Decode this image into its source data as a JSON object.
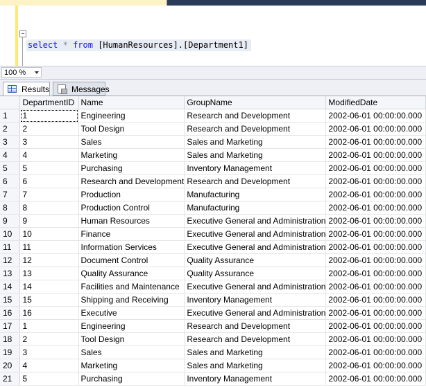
{
  "editor": {
    "sql_keyword_select": "select",
    "sql_star": "*",
    "sql_keyword_from": "from",
    "sql_object": "[HumanResources].[Department1]",
    "collapse_glyph": "−"
  },
  "zoom": {
    "value": "100 %"
  },
  "tabs": {
    "results": "Results",
    "messages": "Messages"
  },
  "grid": {
    "columns": [
      "DepartmentID",
      "Name",
      "GroupName",
      "ModifiedDate"
    ],
    "rows": [
      [
        "1",
        "1",
        "Engineering",
        "Research and Development",
        "2002-06-01 00:00:00.000"
      ],
      [
        "2",
        "2",
        "Tool Design",
        "Research and Development",
        "2002-06-01 00:00:00.000"
      ],
      [
        "3",
        "3",
        "Sales",
        "Sales and Marketing",
        "2002-06-01 00:00:00.000"
      ],
      [
        "4",
        "4",
        "Marketing",
        "Sales and Marketing",
        "2002-06-01 00:00:00.000"
      ],
      [
        "5",
        "5",
        "Purchasing",
        "Inventory Management",
        "2002-06-01 00:00:00.000"
      ],
      [
        "6",
        "6",
        "Research and Development",
        "Research and Development",
        "2002-06-01 00:00:00.000"
      ],
      [
        "7",
        "7",
        "Production",
        "Manufacturing",
        "2002-06-01 00:00:00.000"
      ],
      [
        "8",
        "8",
        "Production Control",
        "Manufacturing",
        "2002-06-01 00:00:00.000"
      ],
      [
        "9",
        "9",
        "Human Resources",
        "Executive General and Administration",
        "2002-06-01 00:00:00.000"
      ],
      [
        "10",
        "10",
        "Finance",
        "Executive General and Administration",
        "2002-06-01 00:00:00.000"
      ],
      [
        "11",
        "11",
        "Information Services",
        "Executive General and Administration",
        "2002-06-01 00:00:00.000"
      ],
      [
        "12",
        "12",
        "Document Control",
        "Quality Assurance",
        "2002-06-01 00:00:00.000"
      ],
      [
        "13",
        "13",
        "Quality Assurance",
        "Quality Assurance",
        "2002-06-01 00:00:00.000"
      ],
      [
        "14",
        "14",
        "Facilities and Maintenance",
        "Executive General and Administration",
        "2002-06-01 00:00:00.000"
      ],
      [
        "15",
        "15",
        "Shipping and Receiving",
        "Inventory Management",
        "2002-06-01 00:00:00.000"
      ],
      [
        "16",
        "16",
        "Executive",
        "Executive General and Administration",
        "2002-06-01 00:00:00.000"
      ],
      [
        "17",
        "1",
        "Engineering",
        "Research and Development",
        "2002-06-01 00:00:00.000"
      ],
      [
        "18",
        "2",
        "Tool Design",
        "Research and Development",
        "2002-06-01 00:00:00.000"
      ],
      [
        "19",
        "3",
        "Sales",
        "Sales and Marketing",
        "2002-06-01 00:00:00.000"
      ],
      [
        "20",
        "4",
        "Marketing",
        "Sales and Marketing",
        "2002-06-01 00:00:00.000"
      ],
      [
        "21",
        "5",
        "Purchasing",
        "Inventory Management",
        "2002-06-01 00:00:00.000"
      ]
    ]
  }
}
